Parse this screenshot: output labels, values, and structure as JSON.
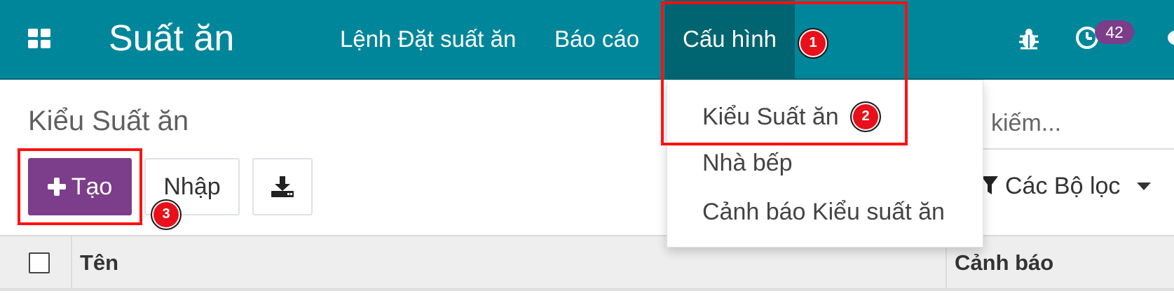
{
  "navbar": {
    "app_title": "Suất ăn",
    "menu": [
      {
        "label": "Lệnh Đặt suất ăn"
      },
      {
        "label": "Báo cáo"
      },
      {
        "label": "Cấu hình"
      }
    ],
    "activity_count": "42",
    "icons": [
      "apps-grid-icon",
      "bug-icon",
      "clock-icon",
      "chat-icon"
    ]
  },
  "control_panel": {
    "breadcrumb": "Kiểu Suất ăn",
    "create_label": "Tạo",
    "import_label": "Nhập",
    "download_icon": "download-icon",
    "search_placeholder": "Tìm kiếm...",
    "filters_label": "Các Bộ lọc"
  },
  "list": {
    "columns": [
      "Tên",
      "Cảnh báo"
    ]
  },
  "dropdown": {
    "items": [
      {
        "label": "Kiểu Suất ăn"
      },
      {
        "label": "Nhà bếp"
      },
      {
        "label": "Cảnh báo Kiểu suất ăn"
      }
    ]
  },
  "annotations": {
    "markers": [
      "1",
      "2",
      "3"
    ],
    "color": "#ff1010"
  },
  "colors": {
    "navbar": "#00869a",
    "navbar_active": "#006570",
    "primary_button": "#7c3d8a",
    "badge": "#7c3d8a"
  }
}
